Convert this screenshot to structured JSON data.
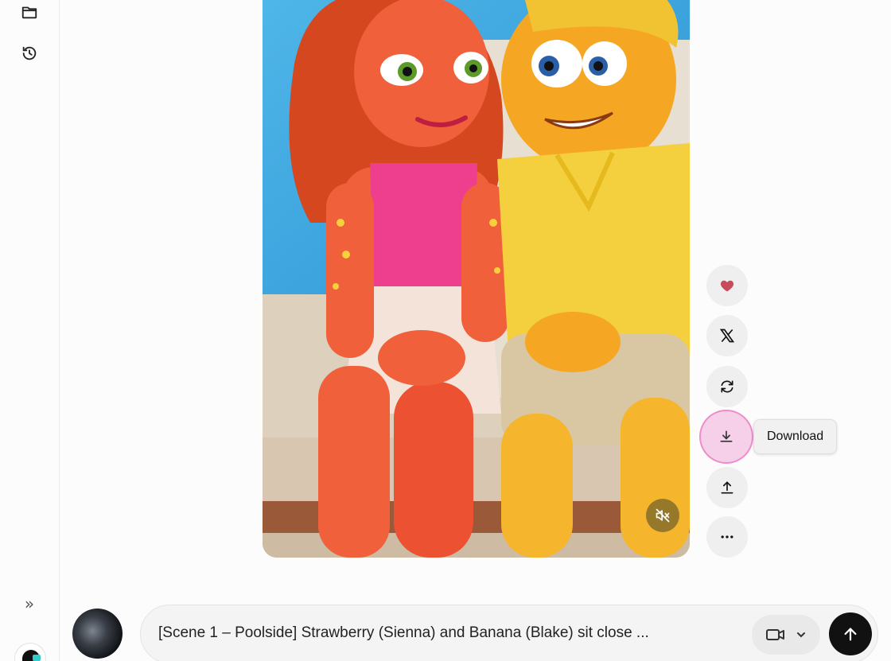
{
  "sidebar": {
    "icons": [
      "folder-icon",
      "history-icon",
      "expand-icon"
    ],
    "expand_glyph": "»"
  },
  "media": {
    "scene": "two cartoon fruit characters sitting on a poolside bench",
    "muted": true
  },
  "actions": {
    "items": [
      {
        "name": "like",
        "icon": "heart-icon",
        "color": "#c94a5a"
      },
      {
        "name": "share-x",
        "icon": "x-logo-icon"
      },
      {
        "name": "regenerate",
        "icon": "refresh-icon"
      },
      {
        "name": "download",
        "icon": "download-icon",
        "hovered": true
      },
      {
        "name": "share",
        "icon": "upload-icon"
      },
      {
        "name": "more",
        "icon": "ellipsis-icon"
      }
    ],
    "tooltip": "Download"
  },
  "composer": {
    "prompt": "[Scene 1 – Poolside] Strawberry (Sienna) and Banana (Blake) sit close ...",
    "mode_icon": "video-camera-icon",
    "send_icon": "arrow-up-icon"
  },
  "colors": {
    "accent_pink": "#ee8ccc",
    "send_button": "#111111"
  }
}
